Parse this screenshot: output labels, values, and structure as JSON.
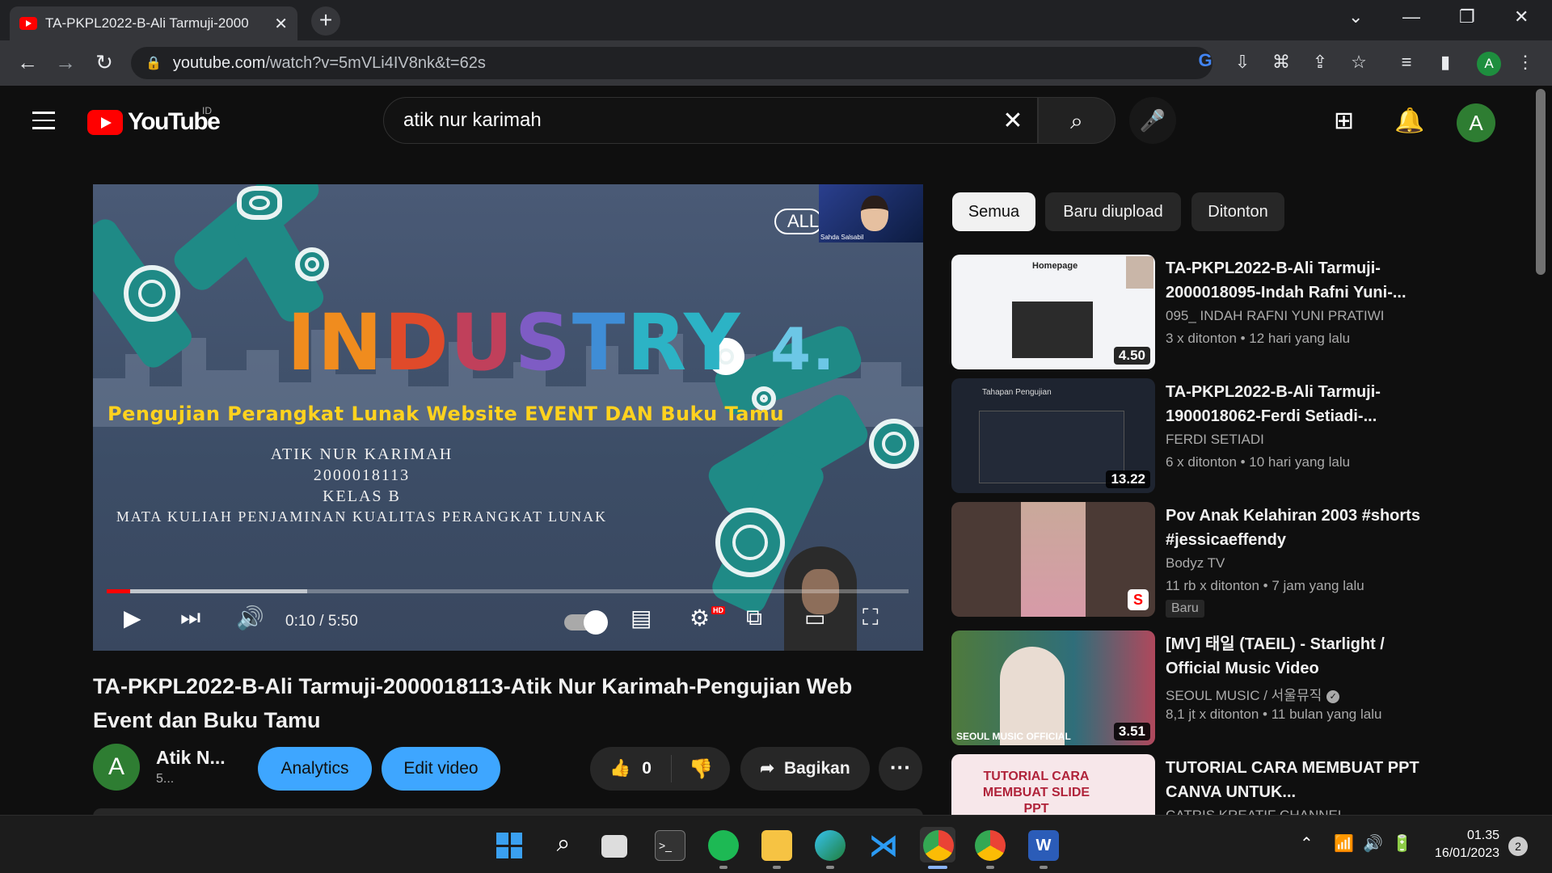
{
  "browser": {
    "tab_title": "TA-PKPL2022-B-Ali Tarmuji-2000",
    "url_host": "youtube.com",
    "url_path": "/watch?v=5mVLi4IV8nk&t=62s",
    "profile_initial": "A"
  },
  "masthead": {
    "logo_text": "YouTube",
    "country_code": "ID",
    "search_query": "atik nur karimah",
    "avatar_initial": "A"
  },
  "player": {
    "slide_title_letters": [
      "IN",
      "D",
      "U",
      "S",
      "T",
      "R",
      "Y"
    ],
    "slide_version": "4.",
    "slide_subtitle": "Pengujian Perangkat Lunak Website EVENT DAN Buku Tamu",
    "slide_lines": [
      "ATIK NUR KARIMAH",
      "2000018113",
      "KELAS  B",
      "MATA KULIAH PENJAMINAN KUALITAS PERANGKAT LUNAK"
    ],
    "pip_name": "Sahda Salsabil",
    "all_pill": "ALL",
    "time_current": "0:10",
    "time_total": "5:50",
    "time_display": "0:10 / 5:50",
    "progress_fraction": 0.029,
    "buffered_fraction": 0.25,
    "hd_badge": "HD"
  },
  "video": {
    "title": "TA-PKPL2022-B-Ali Tarmuji-2000018113-Atik Nur Karimah-Pengujian Web Event dan Buku Tamu",
    "channel_initial": "A",
    "channel_name": "Atik N...",
    "channel_subs": "5...",
    "analytics_label": "Analytics",
    "edit_label": "Edit video",
    "like_count": "0",
    "share_label": "Bagikan"
  },
  "chips": [
    "Semua",
    "Baru diupload",
    "Ditonton"
  ],
  "recommendations": [
    {
      "title": "TA-PKPL2022-B-Ali Tarmuji-2000018095-Indah Rafni Yuni-...",
      "channel": "095_ INDAH RAFNI YUNI PRATIWI",
      "meta": "3 x ditonton  • 12 hari yang lalu",
      "duration": "4.50",
      "thumb_heading": "Homepage"
    },
    {
      "title": "TA-PKPL2022-B-Ali Tarmuji-1900018062-Ferdi Setiadi-...",
      "channel": "FERDI SETIADI",
      "meta": "6 x ditonton  • 10 hari yang lalu",
      "duration": "13.22",
      "thumb_heading": "Tahapan Pengujian"
    },
    {
      "title": "Pov Anak Kelahiran 2003 #shorts #jessicaeffendy",
      "channel": "Bodyz TV",
      "meta": "11 rb x ditonton  • 7 jam yang lalu",
      "badge": "Baru"
    },
    {
      "title": "[MV] 태일 (TAEIL) - Starlight / Official Music Video",
      "channel": "SEOUL MUSIC / 서울뮤직",
      "meta": "8,1 jt x ditonton  • 11 bulan yang lalu",
      "duration": "3.51",
      "thumb_caption": "SEOUL MUSIC  OFFICIAL"
    },
    {
      "title": "TUTORIAL CARA MEMBUAT PPT CANVA UNTUK...",
      "channel": "CATRIS KREATIF CHANNEL",
      "thumb_caption": "TUTORIAL CARA MEMBUAT SLIDE PPT"
    }
  ],
  "taskbar": {
    "time": "01.35",
    "date": "16/01/2023",
    "notification_count": "2"
  }
}
